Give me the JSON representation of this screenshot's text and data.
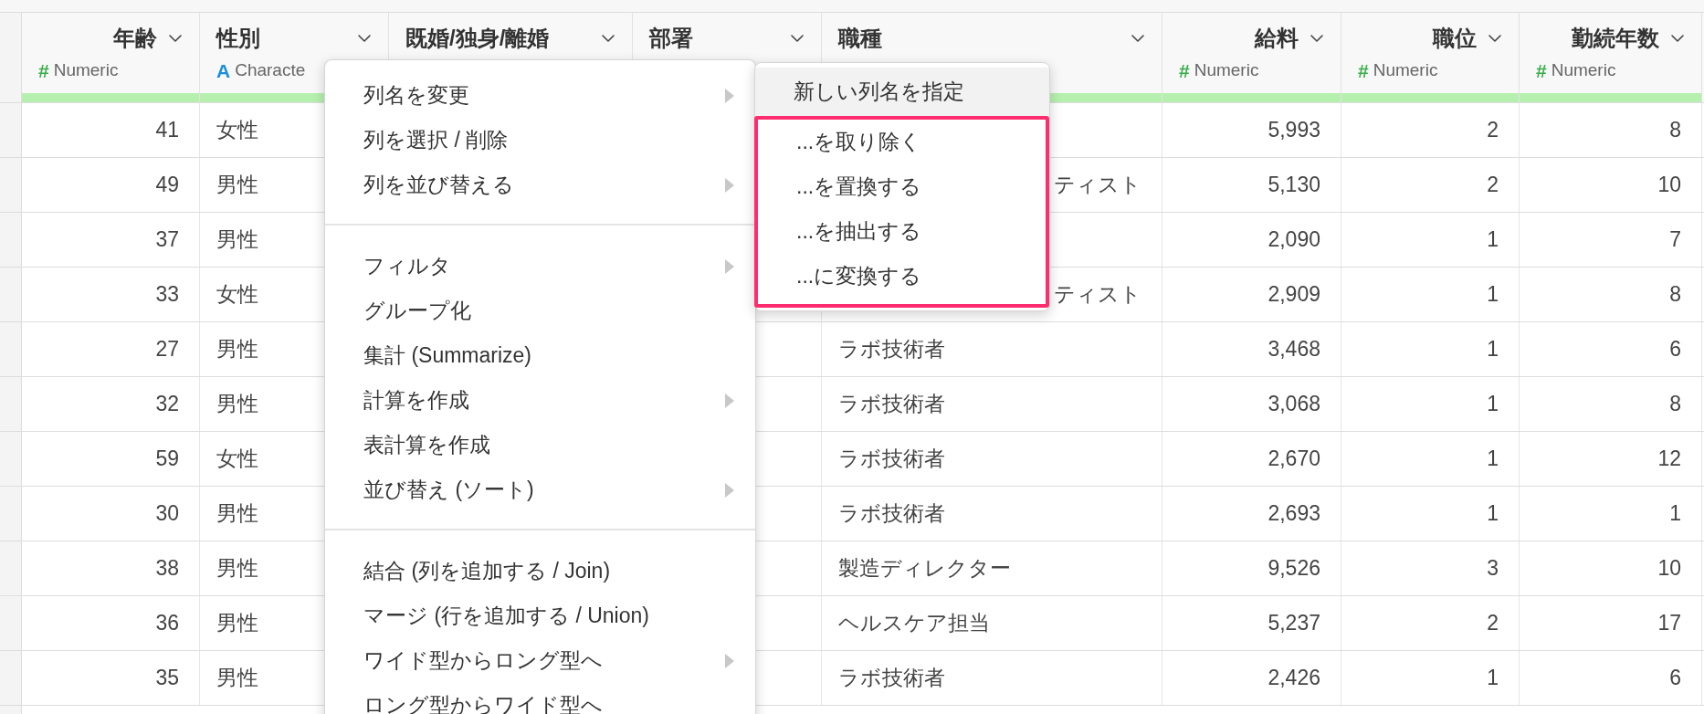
{
  "table": {
    "columns": [
      {
        "name": "年齢",
        "type": "Numeric",
        "type_icon": "#",
        "kind": "numeric"
      },
      {
        "name": "性別",
        "type": "Characte",
        "type_icon": "A",
        "kind": "character"
      },
      {
        "name": "既婚/独身/離婚"
      },
      {
        "name": "部署"
      },
      {
        "name": "職種"
      },
      {
        "name": "給料",
        "type": "Numeric",
        "type_icon": "#",
        "kind": "numeric"
      },
      {
        "name": "職位",
        "type": "Numeric",
        "type_icon": "#",
        "kind": "numeric"
      },
      {
        "name": "勤続年数",
        "type": "Numeric",
        "type_icon": "#",
        "kind": "numeric"
      }
    ],
    "rows": [
      {
        "cells": [
          "41",
          "女性",
          null,
          null,
          null,
          "5,993",
          "2",
          "8"
        ]
      },
      {
        "cells": [
          "49",
          "男性",
          null,
          null,
          "ティスト",
          "5,130",
          "2",
          "10"
        ]
      },
      {
        "cells": [
          "37",
          "男性",
          null,
          null,
          null,
          "2,090",
          "1",
          "7"
        ]
      },
      {
        "cells": [
          "33",
          "女性",
          null,
          null,
          "ティスト",
          "2,909",
          "1",
          "8"
        ]
      },
      {
        "cells": [
          "27",
          "男性",
          null,
          null,
          "ラボ技術者",
          "3,468",
          "1",
          "6"
        ]
      },
      {
        "cells": [
          "32",
          "男性",
          null,
          null,
          "ラボ技術者",
          "3,068",
          "1",
          "8"
        ]
      },
      {
        "cells": [
          "59",
          "女性",
          null,
          null,
          "ラボ技術者",
          "2,670",
          "1",
          "12"
        ]
      },
      {
        "cells": [
          "30",
          "男性",
          null,
          null,
          "ラボ技術者",
          "2,693",
          "1",
          "1"
        ]
      },
      {
        "cells": [
          "38",
          "男性",
          null,
          null,
          "製造ディレクター",
          "9,526",
          "3",
          "10"
        ]
      },
      {
        "cells": [
          "36",
          "男性",
          null,
          null,
          "ヘルスケア担当",
          "5,237",
          "2",
          "17"
        ]
      },
      {
        "cells": [
          "35",
          "男性",
          null,
          null,
          "ラボ技術者",
          "2,426",
          "1",
          "6"
        ]
      }
    ]
  },
  "context_menu": {
    "sections": [
      [
        {
          "label": "列名を変更",
          "submenu": true
        },
        {
          "label": "列を選択 / 削除",
          "submenu": false
        },
        {
          "label": "列を並び替える",
          "submenu": true
        }
      ],
      [
        {
          "label": "フィルタ",
          "submenu": true
        },
        {
          "label": "グループ化",
          "submenu": false
        },
        {
          "label": "集計 (Summarize)",
          "submenu": false
        },
        {
          "label": "計算を作成",
          "submenu": true
        },
        {
          "label": "表計算を作成",
          "submenu": false
        },
        {
          "label": "並び替え (ソート)",
          "submenu": true
        }
      ],
      [
        {
          "label": "結合 (列を追加する / Join)",
          "submenu": false
        },
        {
          "label": "マージ (行を追加する / Union)",
          "submenu": false
        },
        {
          "label": "ワイド型からロング型へ",
          "submenu": true
        },
        {
          "label": "ロング型からワイド型へ",
          "submenu": false
        }
      ]
    ]
  },
  "submenu": {
    "items": [
      {
        "label": "新しい列名を指定",
        "selected": true,
        "highlighted": false
      },
      {
        "label": "...を取り除く",
        "selected": false,
        "highlighted": true
      },
      {
        "label": "...を置換する",
        "selected": false,
        "highlighted": true
      },
      {
        "label": "...を抽出する",
        "selected": false,
        "highlighted": true
      },
      {
        "label": "...に変換する",
        "selected": false,
        "highlighted": true
      }
    ]
  }
}
